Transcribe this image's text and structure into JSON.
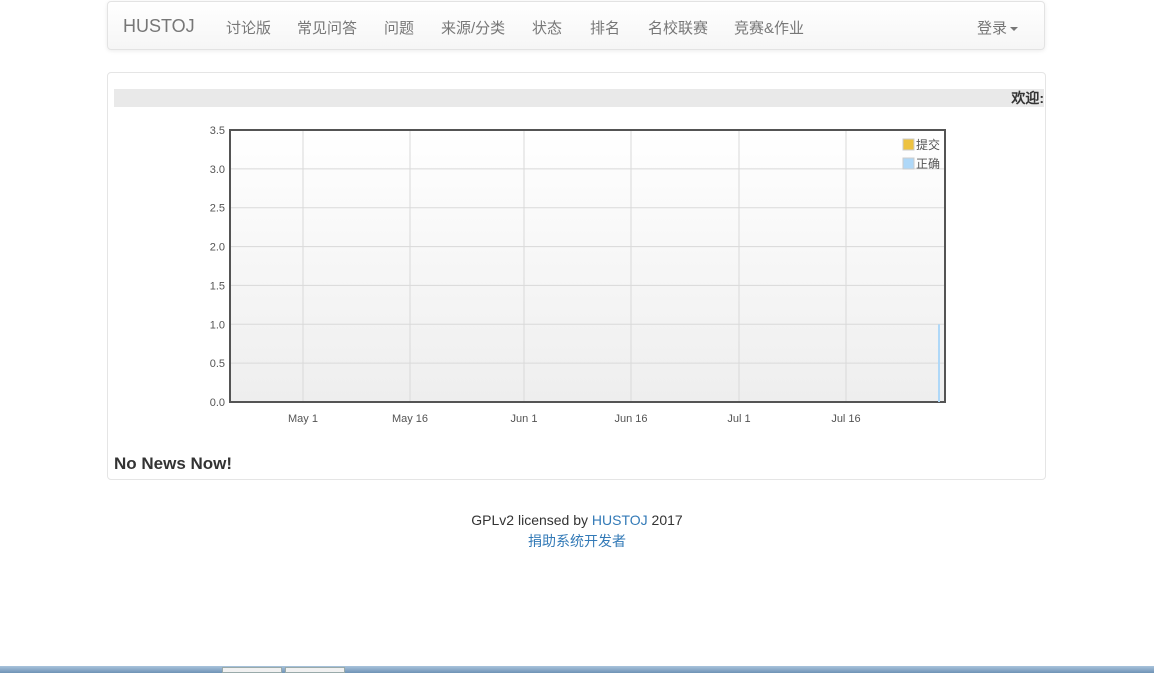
{
  "navbar": {
    "brand": "HUSTOJ",
    "items": [
      "讨论版",
      "常见问答",
      "问题",
      "来源/分类",
      "状态",
      "排名",
      "名校联赛",
      "竞赛&作业"
    ],
    "login": "登录"
  },
  "marquee": {
    "text": "欢迎:"
  },
  "chart_data": {
    "type": "line",
    "x_ticks": [
      "May 1",
      "May 16",
      "Jun 1",
      "Jun 16",
      "Jul 1",
      "Jul 16"
    ],
    "y_ticks": [
      "0.0",
      "0.5",
      "1.0",
      "1.5",
      "2.0",
      "2.5",
      "3.0",
      "3.5"
    ],
    "ylim": [
      0,
      3.5
    ],
    "grid": true,
    "legend_position": "top-right",
    "series": [
      {
        "name": "提交",
        "color": "#edc240",
        "points": []
      },
      {
        "name": "正确",
        "color": "#afd8f8",
        "points": [
          {
            "x": "Jul 30",
            "y": 1
          }
        ]
      }
    ]
  },
  "news": {
    "title": "No News Now!"
  },
  "footer": {
    "prefix": "GPLv2 licensed by",
    "link": "HUSTOJ",
    "year": "2017",
    "donate": "捐助系统开发者"
  }
}
